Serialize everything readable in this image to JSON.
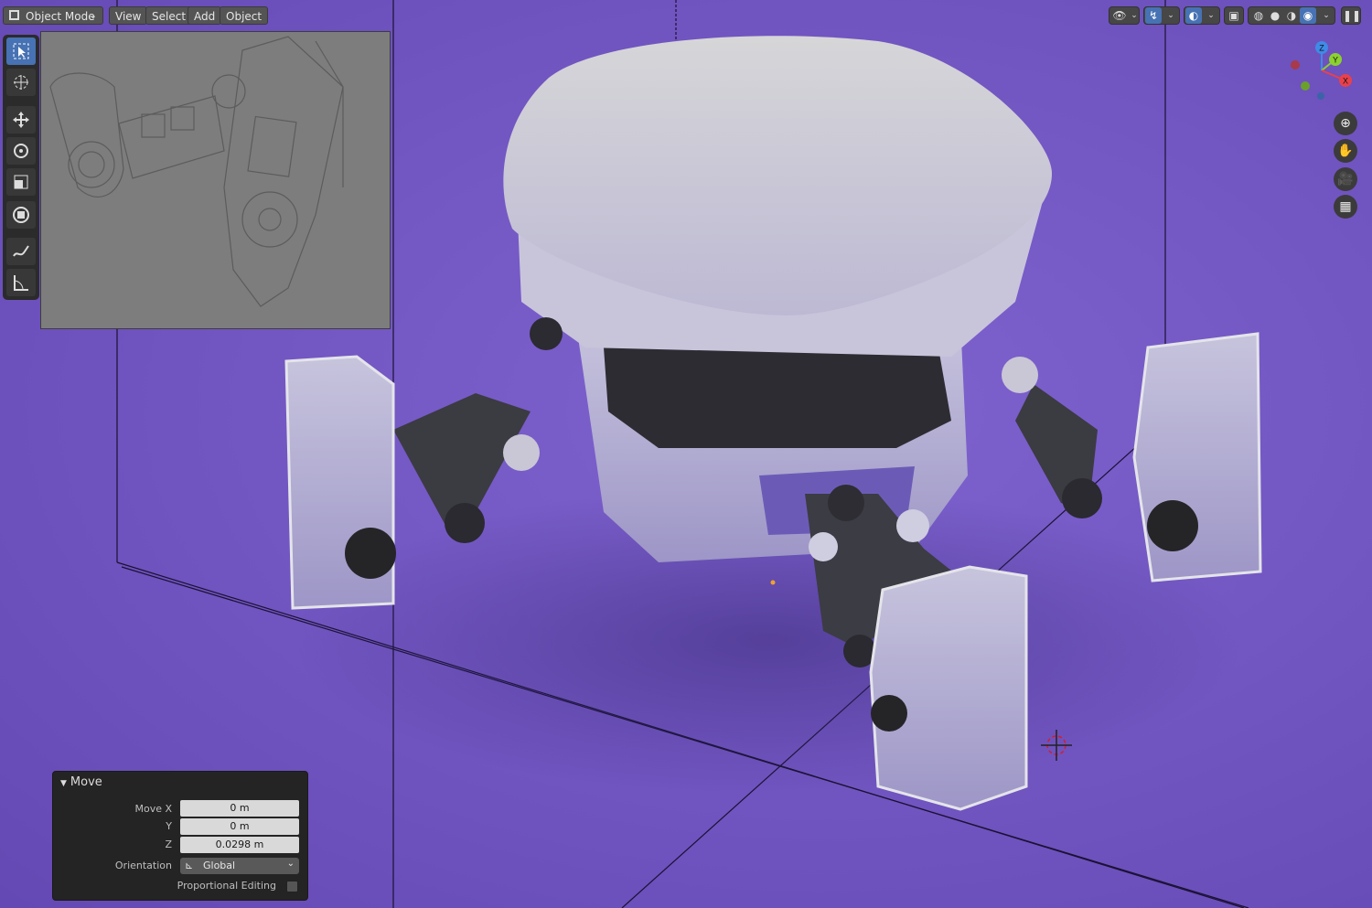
{
  "header": {
    "mode": "Object Mode",
    "menus": {
      "view": "View",
      "select": "Select",
      "add": "Add",
      "object": "Object"
    },
    "right_icons": [
      "eye-icon",
      "gizmo-icon",
      "overlay-icon",
      "xray-icon",
      "wireframe-shading-icon",
      "solid-shading-icon",
      "material-shading-icon",
      "rendered-shading-icon",
      "pause-icon"
    ]
  },
  "toolbar": {
    "tools": [
      "select-box",
      "cursor",
      "move",
      "rotate",
      "scale",
      "transform",
      "annotate",
      "measure"
    ],
    "active": "select-box"
  },
  "gizmo": {
    "x_label": "X",
    "y_label": "Y",
    "z_label": "Z"
  },
  "navigation": [
    "zoom-icon",
    "pan-hand-icon",
    "camera-icon",
    "perspective-grid-icon"
  ],
  "operator": {
    "title": "Move",
    "move_x_label": "Move X",
    "move_x": "0 m",
    "y_label": "Y",
    "y": "0 m",
    "z_label": "Z",
    "z": "0.0298 m",
    "orientation_label": "Orientation",
    "orientation": "Global",
    "proportional_label": "Proportional Editing",
    "proportional_checked": false
  },
  "colors": {
    "viewport_bg": "#7357c3",
    "active_tool": "#4772b3",
    "panel_bg": "#242424",
    "axis_x": "#e8414a",
    "axis_y": "#8bd12f",
    "axis_z": "#3f8be8"
  }
}
